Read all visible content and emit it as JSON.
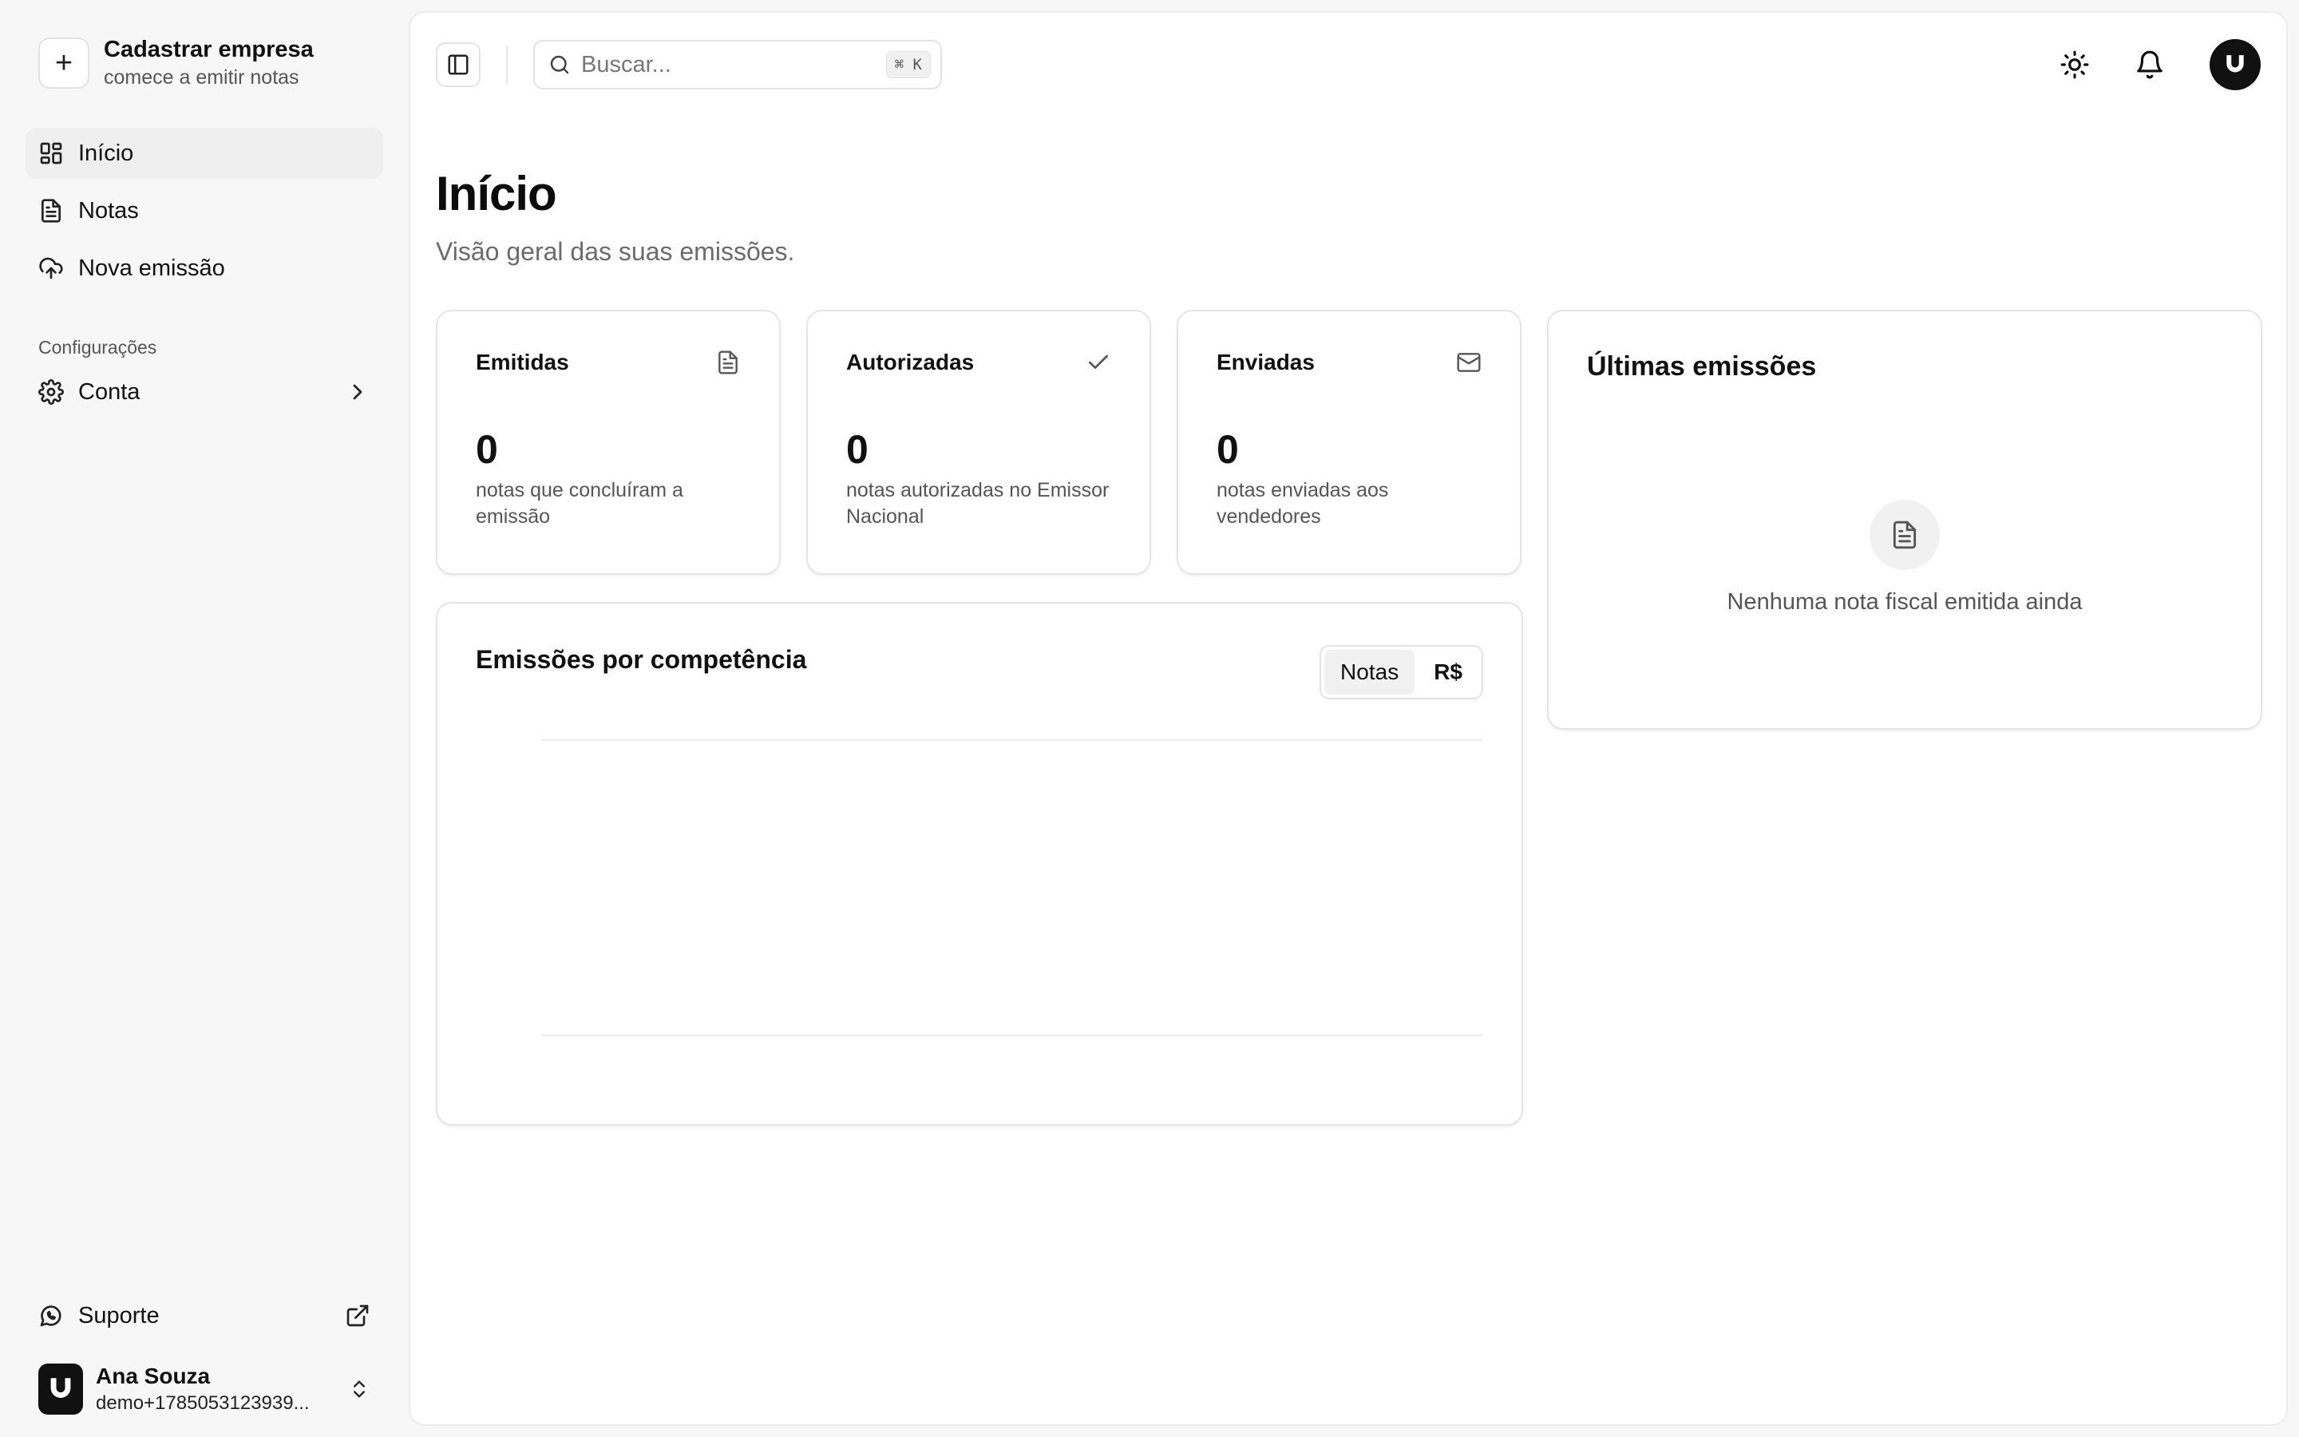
{
  "sidebar": {
    "company": {
      "title": "Cadastrar empresa",
      "subtitle": "comece a emitir notas"
    },
    "nav": [
      {
        "label": "Início",
        "icon": "dashboard-icon",
        "active": true
      },
      {
        "label": "Notas",
        "icon": "document-icon"
      },
      {
        "label": "Nova emissão",
        "icon": "cloud-upload-icon"
      }
    ],
    "section_label": "Configurações",
    "settings_item": {
      "label": "Conta",
      "icon": "gear-icon"
    },
    "support": {
      "label": "Suporte",
      "icon": "whatsapp-icon"
    },
    "user": {
      "name": "Ana Souza",
      "email": "demo+1785053123939..."
    }
  },
  "topbar": {
    "search_placeholder": "Buscar...",
    "shortcut": "⌘ K"
  },
  "page": {
    "title": "Início",
    "subtitle": "Visão geral das suas emissões."
  },
  "stats": [
    {
      "label": "Emitidas",
      "value": "0",
      "desc": "notas que concluíram a emissão",
      "icon": "document-icon"
    },
    {
      "label": "Autorizadas",
      "value": "0",
      "desc": "notas autorizadas no Emissor Nacional",
      "icon": "check-icon"
    },
    {
      "label": "Enviadas",
      "value": "0",
      "desc": "notas enviadas aos vendedores",
      "icon": "mail-icon"
    }
  ],
  "chart": {
    "title": "Emissões por competência",
    "toggle": [
      "Notas",
      "R$"
    ],
    "active_toggle": "Notas"
  },
  "latest": {
    "title": "Últimas emissões",
    "empty_text": "Nenhuma nota fiscal emitida ainda"
  },
  "chart_data": {
    "type": "bar",
    "title": "Emissões por competência",
    "categories": [],
    "values": [],
    "xlabel": "",
    "ylabel": ""
  }
}
